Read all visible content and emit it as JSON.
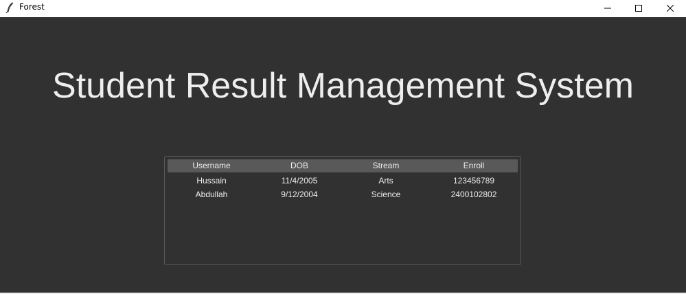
{
  "window": {
    "title": "Forest",
    "app_icon": "feather-icon",
    "controls": [
      "minimize-icon",
      "maximize-icon",
      "close-icon"
    ]
  },
  "main": {
    "heading": "Student Result Management System"
  },
  "table": {
    "columns": [
      "Username",
      "DOB",
      "Stream",
      "Enroll"
    ],
    "rows": [
      [
        "Hussain",
        "11/4/2005",
        "Arts",
        "123456789"
      ],
      [
        "Abdullah",
        "9/12/2004",
        "Science",
        "2400102802"
      ]
    ]
  },
  "colors": {
    "background": "#313131",
    "header_bg": "#595959",
    "text": "#eeeeee"
  }
}
